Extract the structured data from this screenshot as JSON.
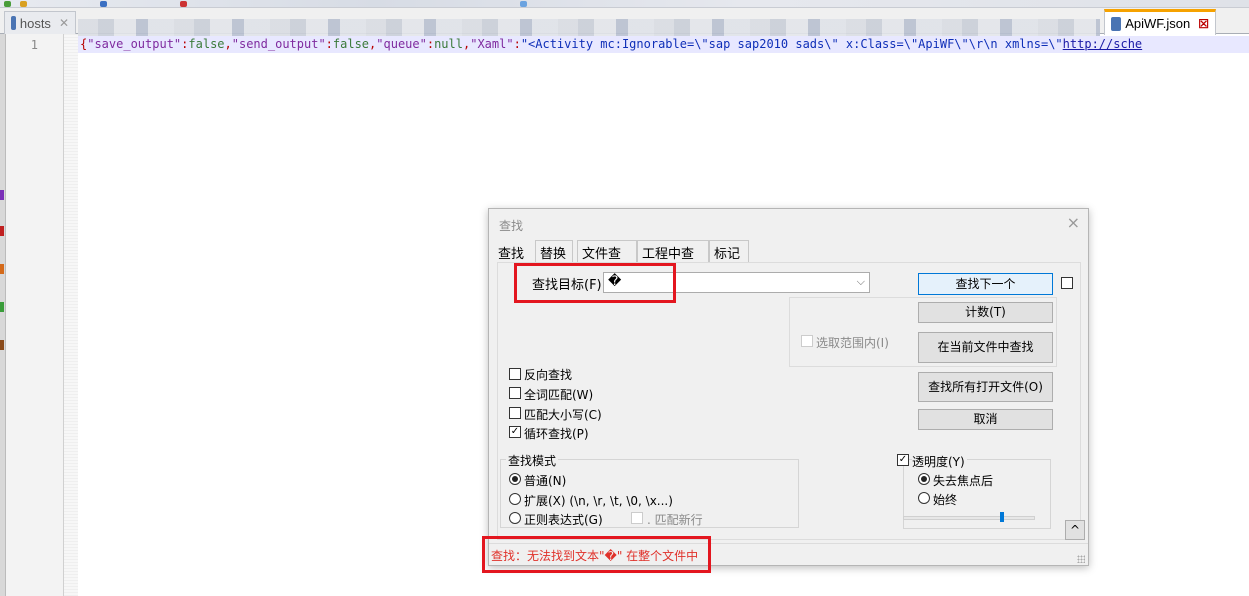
{
  "tabs": [
    {
      "label": "hosts",
      "active": false
    },
    {
      "label": "ApiWF.json",
      "active": true
    }
  ],
  "editor": {
    "line_number": "1",
    "code_segments": [
      {
        "t": "{",
        "c": "p"
      },
      {
        "t": "\"save_output\"",
        "c": "k"
      },
      {
        "t": ":",
        "c": "p"
      },
      {
        "t": "false",
        "c": "s"
      },
      {
        "t": ",",
        "c": "p"
      },
      {
        "t": "\"send_output\"",
        "c": "k"
      },
      {
        "t": ":",
        "c": "p"
      },
      {
        "t": "false",
        "c": "s"
      },
      {
        "t": ",",
        "c": "p"
      },
      {
        "t": "\"queue\"",
        "c": "k"
      },
      {
        "t": ":",
        "c": "p"
      },
      {
        "t": "null",
        "c": "s"
      },
      {
        "t": ",",
        "c": "p"
      },
      {
        "t": "\"Xaml\"",
        "c": "k"
      },
      {
        "t": ":",
        "c": "p"
      },
      {
        "t": "\"<Activity mc:Ignorable=\\\"sap sap2010 sads\\\" x:Class=\\\"ApiWF\\\"\\r\\n xmlns=\\\"",
        "c": "v"
      },
      {
        "t": "http://sche",
        "c": "u"
      }
    ]
  },
  "dialog": {
    "title": "查找",
    "close": "×",
    "tabs": [
      "查找",
      "替换",
      "文件查找",
      "工程中查找",
      "标记"
    ],
    "find_label": "查找目标(F)：",
    "find_value": "�",
    "buttons": {
      "find_next": "查找下一个",
      "count": "计数(T)",
      "find_in_current": "在当前文件中查找",
      "find_all_open": "查找所有打开文件(O)",
      "cancel": "取消"
    },
    "in_selection": "选取范围内(I)",
    "options": [
      {
        "label": "反向查找",
        "checked": false
      },
      {
        "label": "全词匹配(W)",
        "checked": false
      },
      {
        "label": "匹配大小写(C)",
        "checked": false
      },
      {
        "label": "循环查找(P)",
        "checked": true
      }
    ],
    "search_mode": {
      "title": "查找模式",
      "items": [
        {
          "label": "普通(N)",
          "selected": true
        },
        {
          "label": "扩展(X) (\\n, \\r, \\t, \\0, \\x...)",
          "selected": false
        },
        {
          "label": "正则表达式(G)",
          "selected": false
        }
      ],
      "match_newline": ". 匹配新行"
    },
    "transparency": {
      "label": "透明度(Y)",
      "checked": true,
      "items": [
        {
          "label": "失去焦点后",
          "selected": true
        },
        {
          "label": "始终",
          "selected": false
        }
      ],
      "level": 0.75
    },
    "up_button": "^",
    "status": "查找：无法找到文本\"�\" 在整个文件中"
  },
  "colors": {
    "annotation_red": "#e3161f",
    "status_red": "#e0312a",
    "accent_blue": "#0078d7"
  }
}
